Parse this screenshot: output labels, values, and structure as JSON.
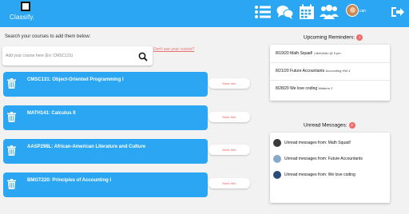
{
  "app": {
    "name": "Classify."
  },
  "header": {
    "user_label": "can"
  },
  "search": {
    "label": "Search your courses to add them below:",
    "placeholder": "Add your course here (Ex: CMSC131)",
    "missing_link": "Don't see your course?"
  },
  "courses": [
    {
      "title": "CMSC131: Object-Oriented Programming I",
      "more": "More Info"
    },
    {
      "title": "MATH141: Calculus II",
      "more": "More Info"
    },
    {
      "title": "AASP298L: African-American Literature and Culture",
      "more": "More Info"
    },
    {
      "title": "BMGT220: Principles of Accounting I",
      "more": "More Info"
    }
  ],
  "reminders": {
    "title": "Upcoming Reminders:",
    "count": "1",
    "items": [
      {
        "main": "8/19/20 Math Squad! ",
        "sub": "| McKeldin @ 5 pm"
      },
      {
        "main": "8/21/20 Future Accountants ",
        "sub": "Accounting HW 4"
      },
      {
        "main": "8/28/20 We love coding ",
        "sub": "Midterm 2"
      }
    ]
  },
  "messages": {
    "title": "Unread Messages:",
    "count": "4",
    "items": [
      {
        "text": "Unread messages from: Math Squad!",
        "avatar_color": "#3a3a3a"
      },
      {
        "text": "Unread messages from: Future Accountants",
        "avatar_color": "#8aa9c9"
      },
      {
        "text": "Unread messages from: We love coding",
        "avatar_color": "#2a4a7a"
      }
    ]
  },
  "colors": {
    "primary": "#2aa6f2",
    "accent": "#f26b6b"
  }
}
